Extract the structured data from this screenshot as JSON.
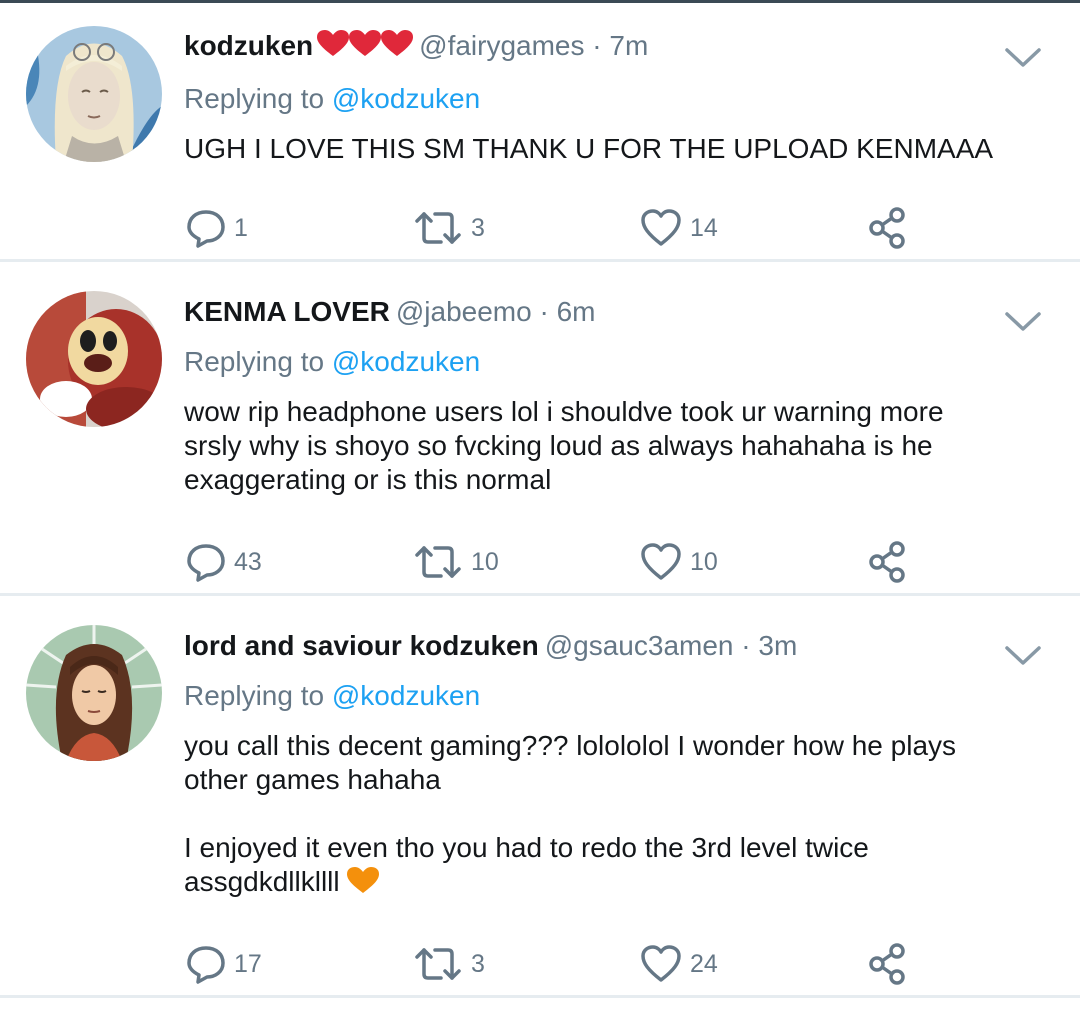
{
  "tweets": [
    {
      "display_name": "kodzuken",
      "emoji_after_name": "hearts-3",
      "handle": "@fairygames",
      "separator": "·",
      "time": "7m",
      "replying_prefix": "Replying to",
      "replying_to": "@kodzuken",
      "text_paragraphs": [
        "UGH I LOVE THIS SM THANK U FOR THE UPLOAD KENMAAA"
      ],
      "replies": "1",
      "retweets": "3",
      "likes": "14",
      "avatar_icon": "avatar-blonde-woman-sketch"
    },
    {
      "display_name": "KENMA LOVER",
      "handle": "@jabeemo",
      "separator": "·",
      "time": "6m",
      "replying_prefix": "Replying to",
      "replying_to": "@kodzuken",
      "text_paragraphs": [
        "wow rip headphone users lol i shouldve took ur warning more srsly why is shoyo so fvcking loud as always hahahaha is he exaggerating or is this normal"
      ],
      "replies": "43",
      "retweets": "10",
      "likes": "10",
      "avatar_icon": "avatar-mascot"
    },
    {
      "display_name": "lord and saviour kodzuken",
      "handle": "@gsauc3amen",
      "separator": "·",
      "time": "3m",
      "replying_prefix": "Replying to",
      "replying_to": "@kodzuken",
      "text_paragraphs": [
        "you call this decent gaming??? lolololol I wonder how he plays other games hahaha",
        "I enjoyed it even tho you had to redo the 3rd level twice assgdkdllkllll"
      ],
      "emoji_after_text": "orange-heart",
      "replies": "17",
      "retweets": "3",
      "likes": "24",
      "avatar_icon": "avatar-longhair-drawing"
    }
  ],
  "colors": {
    "text": "#14171a",
    "muted": "#657786",
    "link": "#1da1f2",
    "divider": "#e6ecf0",
    "icon": "#657786"
  }
}
